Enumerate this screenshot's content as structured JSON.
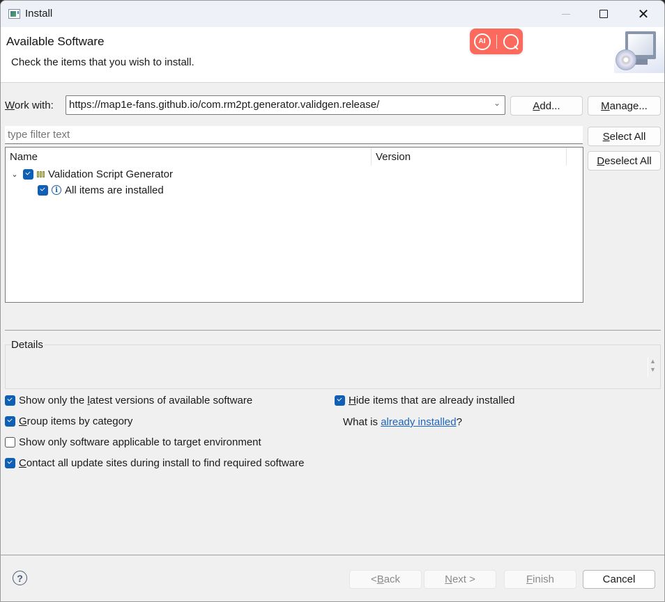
{
  "window": {
    "title": "Install",
    "controls": {
      "minimize": "minimize",
      "maximize": "maximize",
      "close": "✕"
    }
  },
  "banner": {
    "title": "Available Software",
    "description": "Check the items that you wish to install.",
    "ai_badge": {
      "ai_label": "AI",
      "color": "#fb6a5c"
    }
  },
  "work_with": {
    "label_mnemonic": "W",
    "label_rest": "ork with:",
    "value": "https://map1e-fans.github.io/com.rm2pt.generator.validgen.release/",
    "add_mnemonic": "A",
    "add_rest": "dd...",
    "manage_mnemonic": "M",
    "manage_rest": "anage..."
  },
  "filter": {
    "placeholder": "type filter text",
    "value": ""
  },
  "side_buttons": {
    "select_all_mnemonic": "S",
    "select_all_rest": "elect All",
    "deselect_all_mnemonic": "D",
    "deselect_all_rest": "eselect All"
  },
  "tree": {
    "columns": [
      "Name",
      "Version"
    ],
    "rows": [
      {
        "label": "Validation Script Generator",
        "version": "",
        "checked": true,
        "expanded": true,
        "icon": "feature-icon"
      },
      {
        "label": "All items are installed",
        "version": "",
        "checked": true,
        "icon": "info-icon"
      }
    ]
  },
  "details": {
    "label": "Details",
    "text": ""
  },
  "options": {
    "latest_pre": "Show only the ",
    "latest_mnemonic": "l",
    "latest_post": "atest versions of available software",
    "latest_checked": true,
    "group_mnemonic": "G",
    "group_post": "roup items by category",
    "group_checked": true,
    "target_label": "Show only software applicable to target environment",
    "target_checked": false,
    "contact_mnemonic": "C",
    "contact_post": "ontact all update sites during install to find required software",
    "contact_checked": true,
    "hide_mnemonic": "H",
    "hide_post": "ide items that are already installed",
    "hide_checked": true,
    "whatis_pre": "What is ",
    "whatis_link": "already installed",
    "whatis_post": "?"
  },
  "footer": {
    "help": "?",
    "back_pre": "< ",
    "back_mnemonic": "B",
    "back_rest": "ack",
    "next_mnemonic": "N",
    "next_rest": "ext >",
    "finish_mnemonic": "F",
    "finish_rest": "inish",
    "cancel": "Cancel"
  }
}
